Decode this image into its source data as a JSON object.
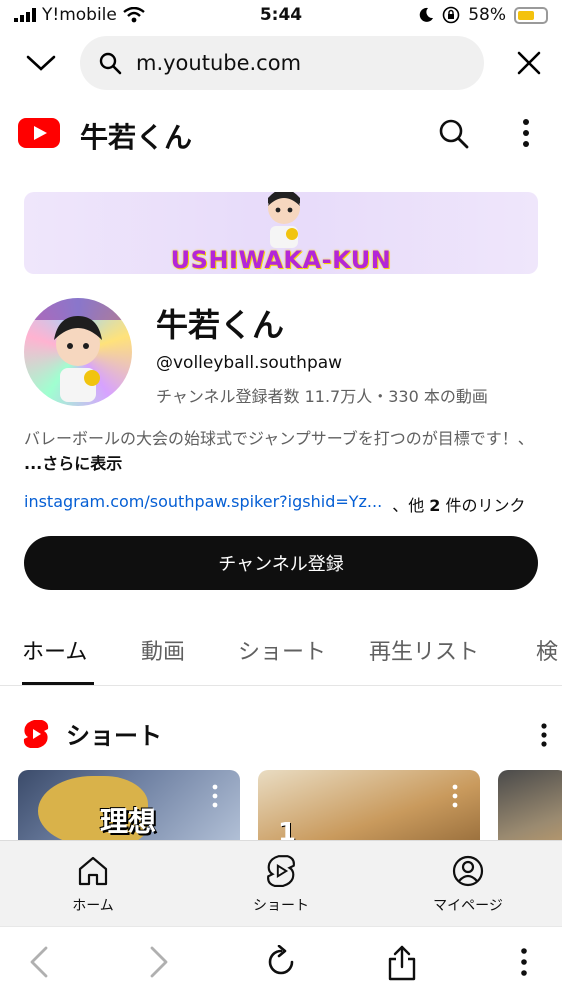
{
  "status_bar": {
    "carrier": "Y!mobile",
    "time": "5:44",
    "battery_percent": "58%",
    "battery_level": 0.58,
    "icons": [
      "signal-icon",
      "wifi-icon",
      "moon-icon",
      "orientation-lock-icon",
      "battery-icon"
    ]
  },
  "browser": {
    "url": "m.youtube.com"
  },
  "header": {
    "title": "牛若くん"
  },
  "banner": {
    "text": "USHIWAKA-KUN"
  },
  "channel": {
    "name": "牛若くん",
    "handle": "@volleyball.southpaw",
    "meta": "チャンネル登録者数 11.7万人・330 本の動画",
    "description": "バレーボールの大会の始球式でジャンプサーブを打つのが目標です！、",
    "more_label": "...さらに表示",
    "link_url": "instagram.com/southpaw.spiker?igshid=Yz...",
    "link_others_prefix": "、他",
    "link_others_count": "2",
    "link_others_suffix": "件のリンク",
    "subscribe_label": "チャンネル登録"
  },
  "tabs": [
    {
      "label": "ホーム",
      "active": true
    },
    {
      "label": "動画",
      "active": false
    },
    {
      "label": "ショート",
      "active": false
    },
    {
      "label": "再生リスト",
      "active": false
    },
    {
      "label": "検",
      "active": false
    }
  ],
  "shorts_shelf": {
    "title": "ショート",
    "cards": [
      {
        "overlay_text": "理想"
      },
      {
        "overlay_text": "1"
      },
      {
        "overlay_text": ""
      }
    ]
  },
  "bottom_nav": {
    "items": [
      {
        "label": "ホーム",
        "icon": "home-icon"
      },
      {
        "label": "ショート",
        "icon": "shorts-icon"
      },
      {
        "label": "マイページ",
        "icon": "account-icon"
      }
    ]
  },
  "safari_toolbar": {
    "icons": [
      "back-icon",
      "forward-icon",
      "reload-icon",
      "share-icon",
      "more-icon"
    ]
  },
  "colors": {
    "youtube_red": "#ff0000",
    "link_blue": "#065fd4",
    "banner_text": "#b327d8",
    "battery_yellow": "#f4c20d"
  }
}
